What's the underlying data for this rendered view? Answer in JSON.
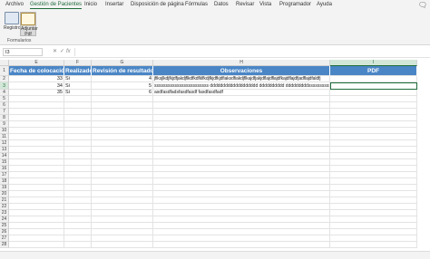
{
  "tabs": [
    "Archivo",
    "Gestión de Pacientes",
    "Inicio",
    "Insertar",
    "Disposición de página",
    "Fórmulas",
    "Datos",
    "Revisar",
    "Vista",
    "Programador",
    "Ayuda"
  ],
  "ribbon": {
    "buttons": [
      {
        "label": "Registro"
      },
      {
        "label": "Adjuntar Pdf"
      }
    ],
    "group_label": "Formularios"
  },
  "formula_bar": {
    "name_box": "I3",
    "cancel_symbol": "✕",
    "enter_symbol": "✓",
    "fx_symbol": "fx",
    "formula": ""
  },
  "columns": [
    {
      "letter": "E"
    },
    {
      "letter": "F"
    },
    {
      "letter": "G"
    },
    {
      "letter": "H"
    },
    {
      "letter": "I"
    }
  ],
  "rows": [
    "1",
    "2",
    "3",
    "4",
    "5",
    "6",
    "7",
    "8",
    "9",
    "10",
    "11",
    "12",
    "13",
    "14",
    "15",
    "16",
    "17",
    "18",
    "19",
    "20",
    "21",
    "22",
    "23",
    "24",
    "25",
    "26",
    "27",
    "28"
  ],
  "table": {
    "headers": [
      "Fecha de colocación",
      "Realizado",
      "Revisión de resultados",
      "Observaciones",
      "PDF"
    ],
    "rows": [
      {
        "fecha": "33",
        "realizado": "Si",
        "revision": "4",
        "obs": "jfiksjlkdjfkjdfjakdjflkdfkdfklfkdjfkjdfkjdfiaksdfiakdjflkajdfjakjdflajdflajdfkajdflajdfjadflajdfaldfj",
        "pdf": ""
      },
      {
        "fecha": "34",
        "realizado": "Si",
        "revision": "5",
        "obs": "ssssssssssssssssssssssss ddddddddddddddddddd dddddddddd dddddddddssssssssss",
        "pdf": ""
      },
      {
        "fecha": "35",
        "realizado": "Si",
        "revision": "6",
        "obs": "asdfasdfadsfasdfasdf fasdfasdfadf",
        "pdf": ""
      }
    ]
  },
  "colors": {
    "header_fill": "#4a86c6",
    "accent": "#1f6b3a"
  },
  "icons": [
    "registro-icon",
    "adjuntar-pdf-icon",
    "comment-icon"
  ]
}
